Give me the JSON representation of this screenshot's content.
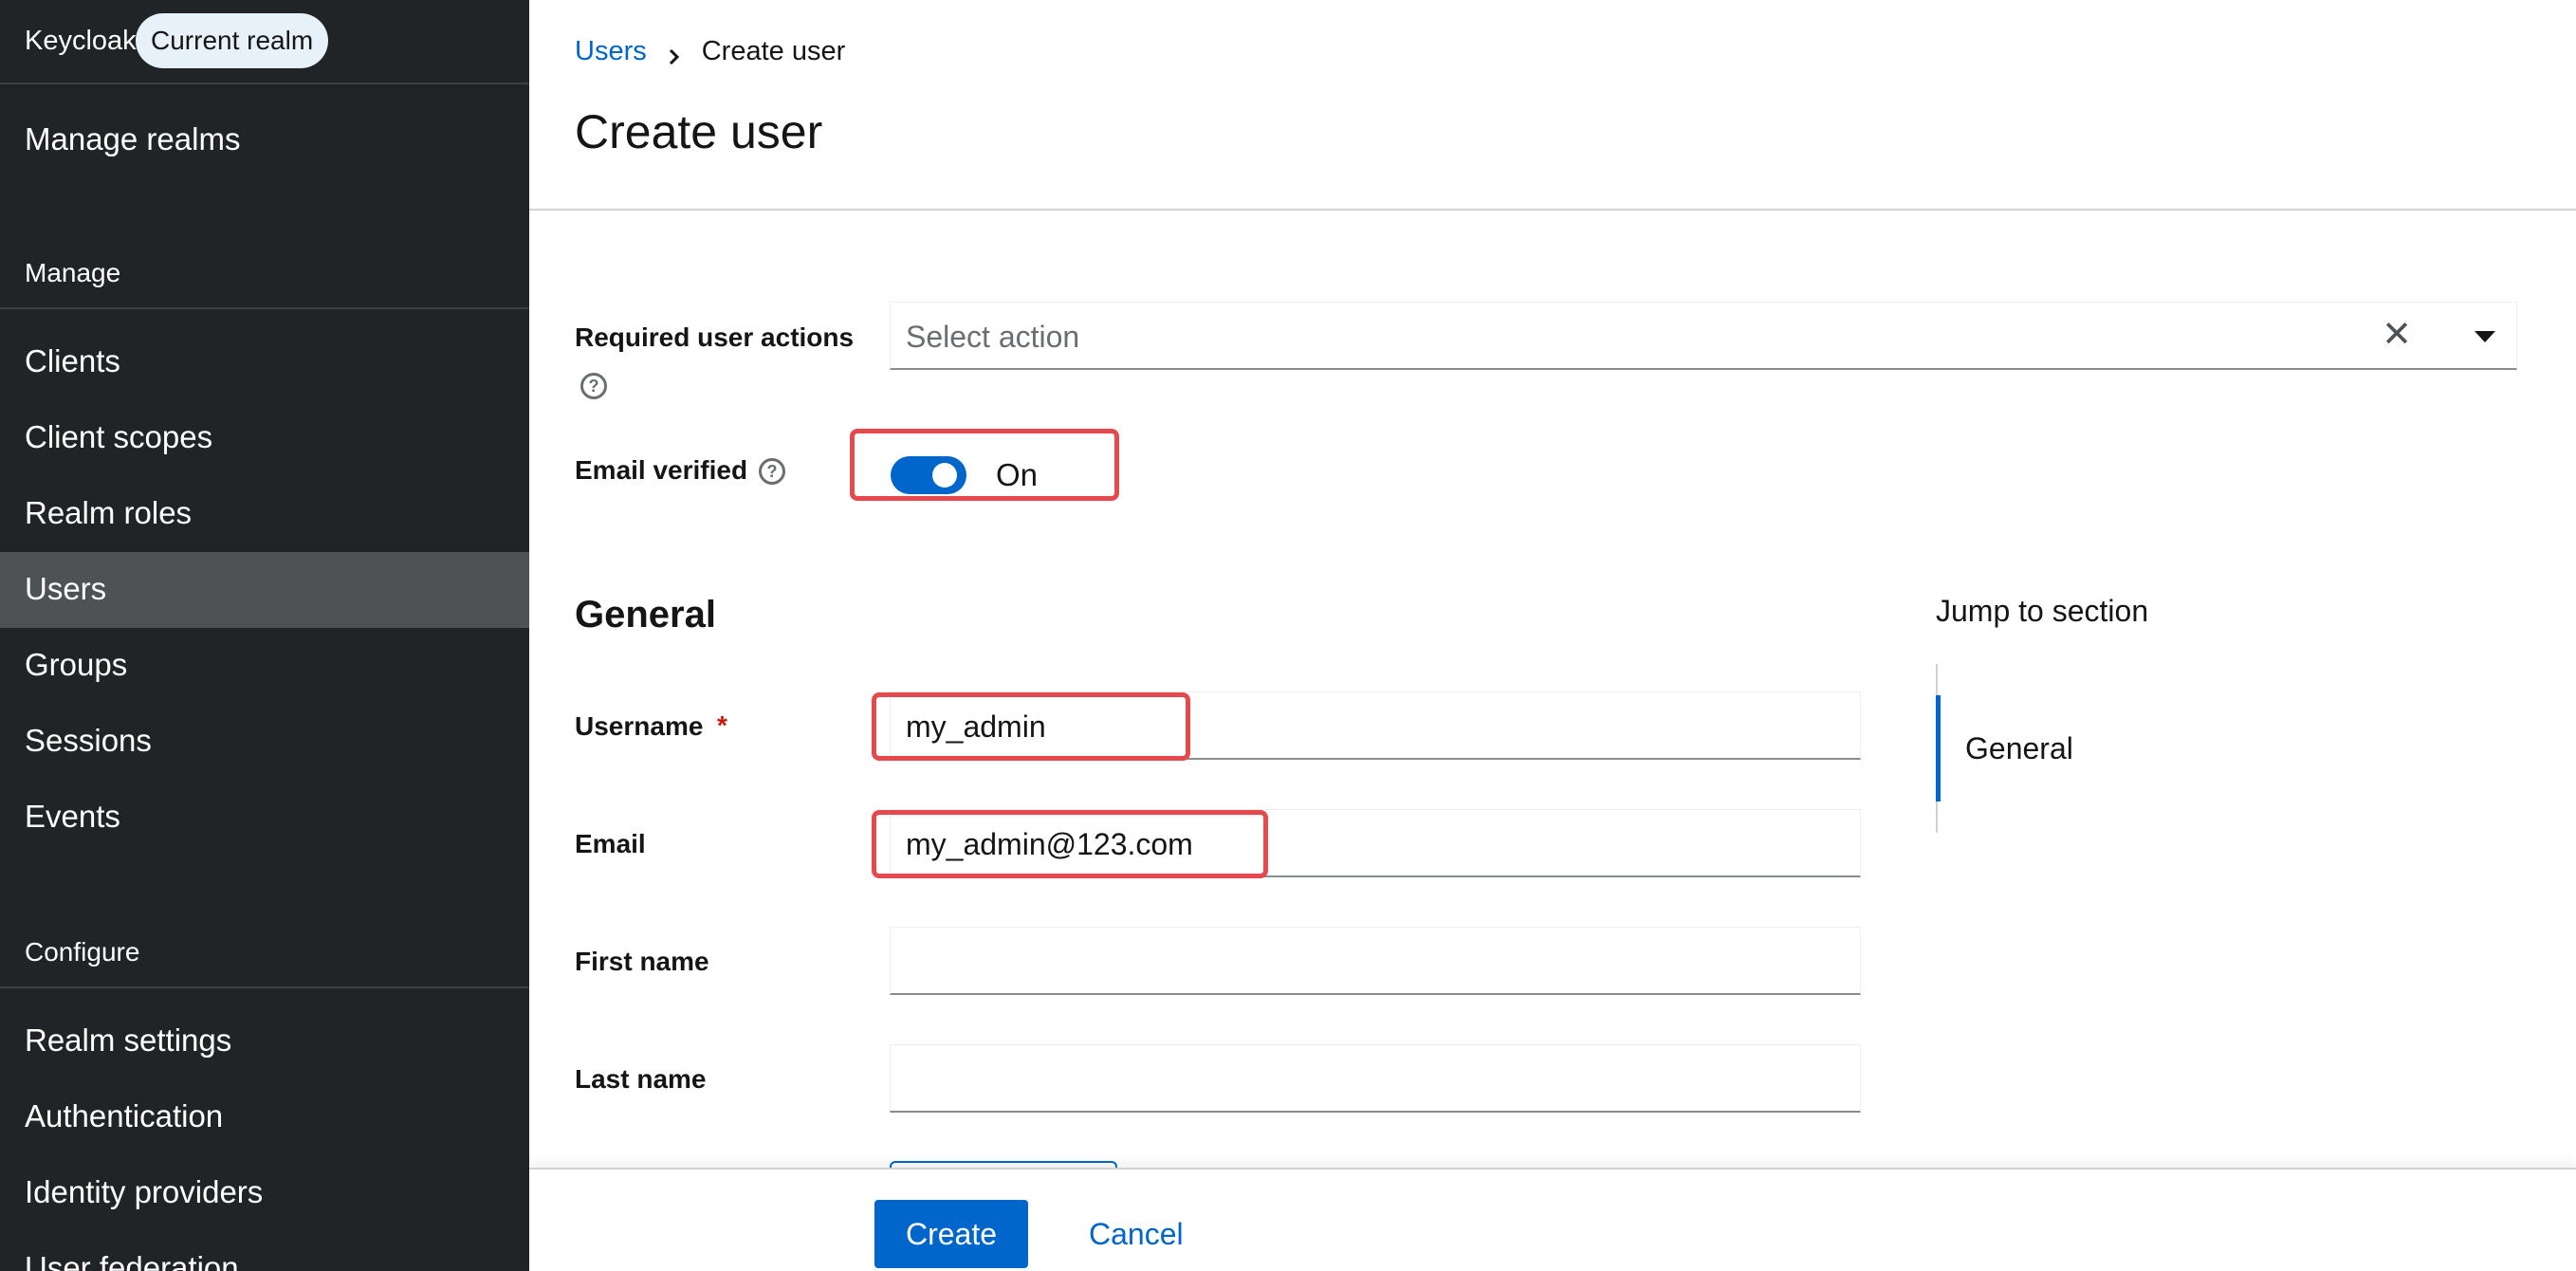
{
  "sidebar": {
    "brand": "Keycloak",
    "realm_pill": "Current realm",
    "manage_realms": "Manage realms",
    "manage_title": "Manage",
    "manage_items": [
      "Clients",
      "Client scopes",
      "Realm roles",
      "Users",
      "Groups",
      "Sessions",
      "Events"
    ],
    "active_item": "Users",
    "configure_title": "Configure",
    "configure_items": [
      "Realm settings",
      "Authentication",
      "Identity providers",
      "User federation"
    ]
  },
  "breadcrumb": {
    "parent": "Users",
    "current": "Create user"
  },
  "page_title": "Create user",
  "form": {
    "required_actions": {
      "label": "Required user actions",
      "placeholder": "Select action"
    },
    "email_verified": {
      "label": "Email verified",
      "state_text": "On",
      "checked": true
    },
    "section_general": "General",
    "username": {
      "label": "Username",
      "value": "my_admin"
    },
    "email": {
      "label": "Email",
      "value": "my_admin@123.com"
    },
    "first_name": {
      "label": "First name",
      "value": ""
    },
    "last_name": {
      "label": "Last name",
      "value": ""
    }
  },
  "jump": {
    "title": "Jump to section",
    "items": [
      "General"
    ]
  },
  "footer": {
    "create": "Create",
    "cancel": "Cancel"
  },
  "colors": {
    "accent": "#0066cc",
    "sidebar_bg": "#212427",
    "highlight": "#e5484d"
  }
}
